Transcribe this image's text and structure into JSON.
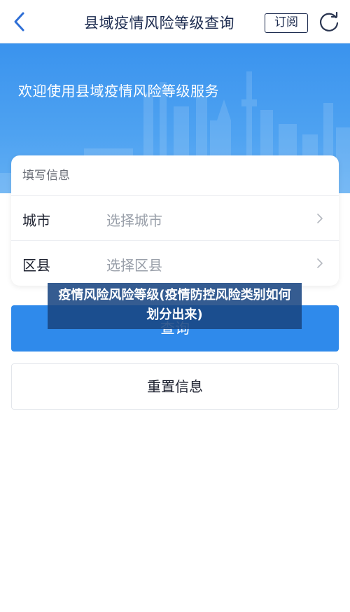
{
  "nav": {
    "title": "县域疫情风险等级查询",
    "subscribe_label": "订阅"
  },
  "banner": {
    "title": "欢迎使用县域疫情风险等级服务"
  },
  "form": {
    "header": "填写信息",
    "rows": [
      {
        "label": "城市",
        "placeholder": "选择城市"
      },
      {
        "label": "区县",
        "placeholder": "选择区县"
      }
    ]
  },
  "actions": {
    "query_label": "查询",
    "reset_label": "重置信息"
  },
  "overlay": {
    "text": "疫情风险风险等级(疫情防控风险类别如何划分出来)"
  },
  "colors": {
    "primary": "#2f8aeb",
    "banner": "#3a93ee",
    "nav_text": "#1b2a4e"
  },
  "icons": {
    "back": "chevron-left-icon",
    "refresh": "refresh-icon",
    "row_arrow": "chevron-right-icon"
  }
}
